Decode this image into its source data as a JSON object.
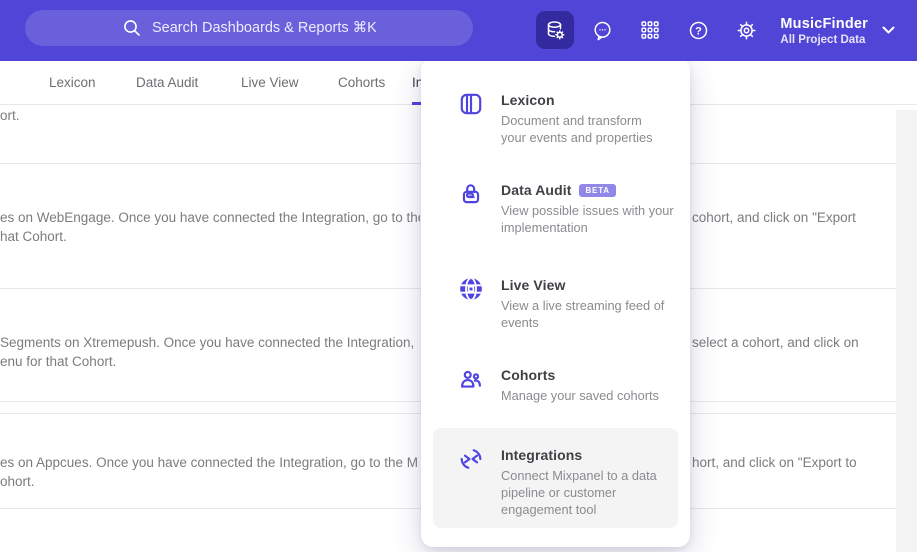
{
  "colors": {
    "accent": "#4f44e0",
    "header_bg": "#5045d6",
    "badge_bg": "#9087e8",
    "highlight_bg": "#f4f4f5"
  },
  "header": {
    "search": {
      "placeholder": "Search Dashboards & Reports ⌘K",
      "icon": "search-icon"
    },
    "icons": [
      "data-management-icon",
      "feedback-chat-icon",
      "apps-grid-icon",
      "help-icon",
      "settings-gear-icon"
    ],
    "project": {
      "name": "MusicFinder",
      "subtitle": "All Project Data",
      "chevron": "chevron-down-icon"
    }
  },
  "tabs": [
    {
      "label": "Lexicon",
      "active": false
    },
    {
      "label": "Data Audit",
      "active": false
    },
    {
      "label": "Live View",
      "active": false
    },
    {
      "label": "Cohorts",
      "active": false
    },
    {
      "label": "Integrations",
      "active": true
    }
  ],
  "menu": {
    "items": [
      {
        "title": "Lexicon",
        "icon": "book-icon",
        "desc": "Document and transform\nyour events and properties"
      },
      {
        "title": "Data Audit",
        "icon": "lock-audit-icon",
        "badge": "BETA",
        "desc": "View possible issues with your\nimplementation"
      },
      {
        "title": "Live View",
        "icon": "globe-icon",
        "desc": "View a live streaming feed of\nevents"
      },
      {
        "title": "Cohorts",
        "icon": "people-icon",
        "desc": "Manage your saved cohorts"
      },
      {
        "title": "Integrations",
        "icon": "sync-arrows-icon",
        "highlighted": true,
        "desc": "Connect Mixpanel to a data\npipeline or customer\nengagement tool"
      }
    ]
  },
  "content": {
    "rows": [
      {
        "left": "ort.",
        "right": ""
      },
      {
        "left": "es on WebEngage. Once you have connected the Integration, go to the\nhat Cohort.",
        "right": "cohort, and click on \"Export"
      },
      {
        "left": "Segments on Xtremepush. Once you have connected the Integration, \nenu for that Cohort.",
        "right": "select a cohort, and click on"
      },
      {
        "left": "es on Appcues. Once you have connected the Integration, go to the M\nohort.",
        "right": "hort, and click on \"Export to"
      }
    ]
  }
}
